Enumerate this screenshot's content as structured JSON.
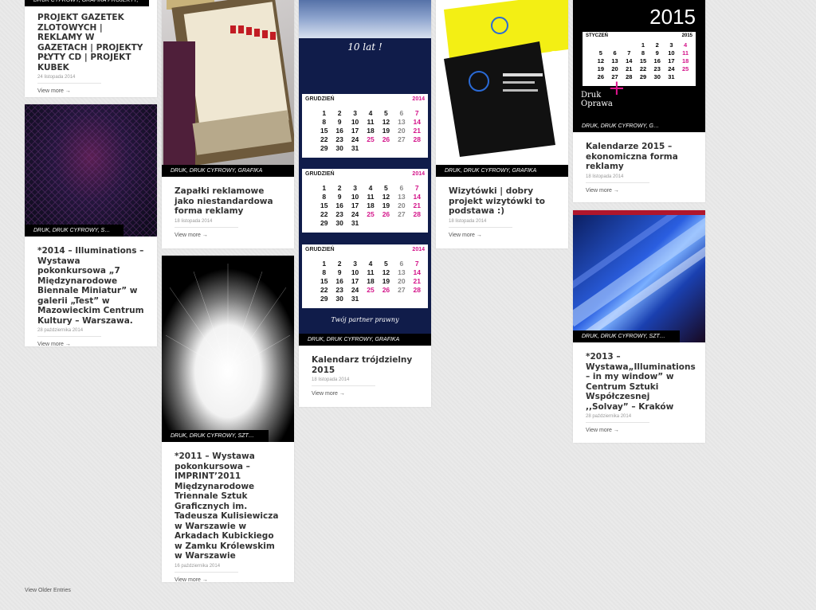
{
  "posts": [
    {
      "categories": "DRUK CYFROWY, GRAFIKA PROJEKTY,",
      "title": "PROJEKT GAZETEK ZLOTOWYCH | REKLAMY W GAZETACH | PROJEKTY PŁYTY CD | PROJEKT KUBEK",
      "date": "24 listopada 2014",
      "more": "View more →"
    },
    {
      "categories": "DRUK, DRUK CYFROWY, SZTUKA",
      "title": "*2014 – Illuminations – Wystawa pokonkursowa „7 Międzynarodowe Biennale Miniatur” w galerii „Test” w Mazowieckim Centrum Kultury – Warszawa.",
      "date": "28 października 2014",
      "more": "View more →"
    },
    {
      "categories": "DRUK, DRUK CYFROWY, GRAFIKA",
      "title": "Zapałki reklamowe jako niestandardowa forma reklamy",
      "date": "18 listopada 2014",
      "more": "View more →"
    },
    {
      "categories": "DRUK, DRUK CYFROWY, SZTUKA",
      "title": "*2011 – Wystawa pokonkursowa – IMPRINT’2011 Międzynarodowe Triennale Sztuk Graficznych im. Tadeusza Kulisiewicza w Warszawie w Arkadach Kubickiego w Zamku Królewskim w Warszawie",
      "date": "16 października 2014",
      "more": "View more →"
    },
    {
      "categories": "DRUK, DRUK CYFROWY, GRAFIKA",
      "title": "Kalendarz trójdzielny 2015",
      "date": "18 listopada 2014",
      "more": "View more →"
    },
    {
      "categories": "DRUK, DRUK CYFROWY, GRAFIKA",
      "title": "Wizytówki | dobry projekt wizytówki to podstawa :)",
      "date": "18 listopada 2014",
      "more": "View more →"
    },
    {
      "categories": "DRUK, DRUK CYFROWY, GRAFIKA",
      "title": "Kalendarze 2015 – ekonomiczna forma reklamy",
      "date": "18 listopada 2014",
      "more": "View more →"
    },
    {
      "categories": "DRUK, DRUK CYFROWY, SZTUKA",
      "title": "*2013 – Wystawa„Illuminations – in my window” w Centrum Sztuki Współczesnej ,,Solvay” – Kraków",
      "date": "28 października 2014",
      "more": "View more →"
    }
  ],
  "calendar_image": {
    "ten_years": "10 lat !",
    "month": "GRUDZIEŃ",
    "year": "2014",
    "tagline": "Twój partner prawny",
    "days": [
      "1",
      "2",
      "3",
      "4",
      "5",
      "6",
      "7",
      "8",
      "9",
      "10",
      "11",
      "12",
      "13",
      "14",
      "15",
      "16",
      "17",
      "18",
      "19",
      "20",
      "21",
      "22",
      "23",
      "24",
      "25",
      "26",
      "27",
      "28",
      "29",
      "30",
      "31"
    ]
  },
  "wall_calendar_image": {
    "year": "2015",
    "month": "STYCZEŃ",
    "brand_line1": "Druk",
    "brand_line2": "Oprawa"
  },
  "pagination": {
    "older": "View Older Entries"
  }
}
